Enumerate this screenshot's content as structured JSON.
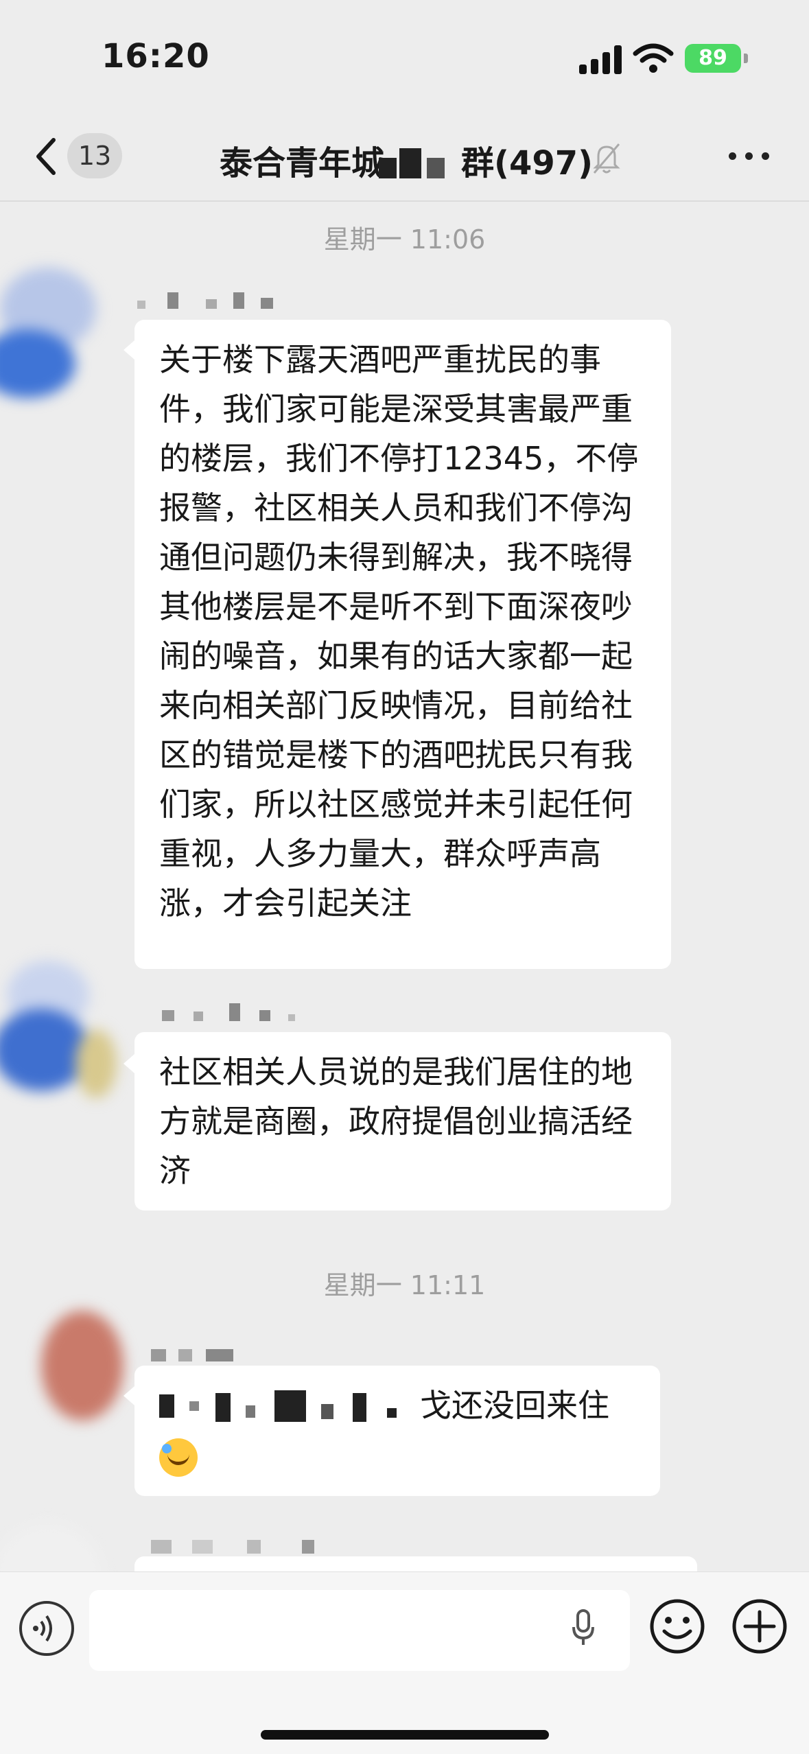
{
  "status_bar": {
    "time": "16:20",
    "battery": "89"
  },
  "nav": {
    "unread_count": "13",
    "title_prefix": "泰合青年城",
    "title_suffix": "群(497)"
  },
  "messages": [
    {
      "timestamp": "星期一 11:06",
      "text": "关于楼下露天酒吧严重扰民的事件，我们家可能是深受其害最严重的楼层，我们不停打12345，不停报警，社区相关人员和我们不停沟通但问题仍未得到解决，我不晓得其他楼层是不是听不到下面深夜吵闹的噪音，如果有的话大家都一起来向相关部门反映情况，目前给社区的错觉是楼下的酒吧扰民只有我们家，所以社区感觉并未引起任何重视，人多力量大，群众呼声高涨，才会引起关注"
    },
    {
      "text": "社区相关人员说的是我们居住的地方就是商圈，政府提倡创业搞活经济"
    },
    {
      "timestamp": "星期一 11:11",
      "text": "戈还没回来住"
    }
  ],
  "colors": {
    "bubble": "#ffffff",
    "background": "#ededed",
    "battery": "#4cd964"
  }
}
